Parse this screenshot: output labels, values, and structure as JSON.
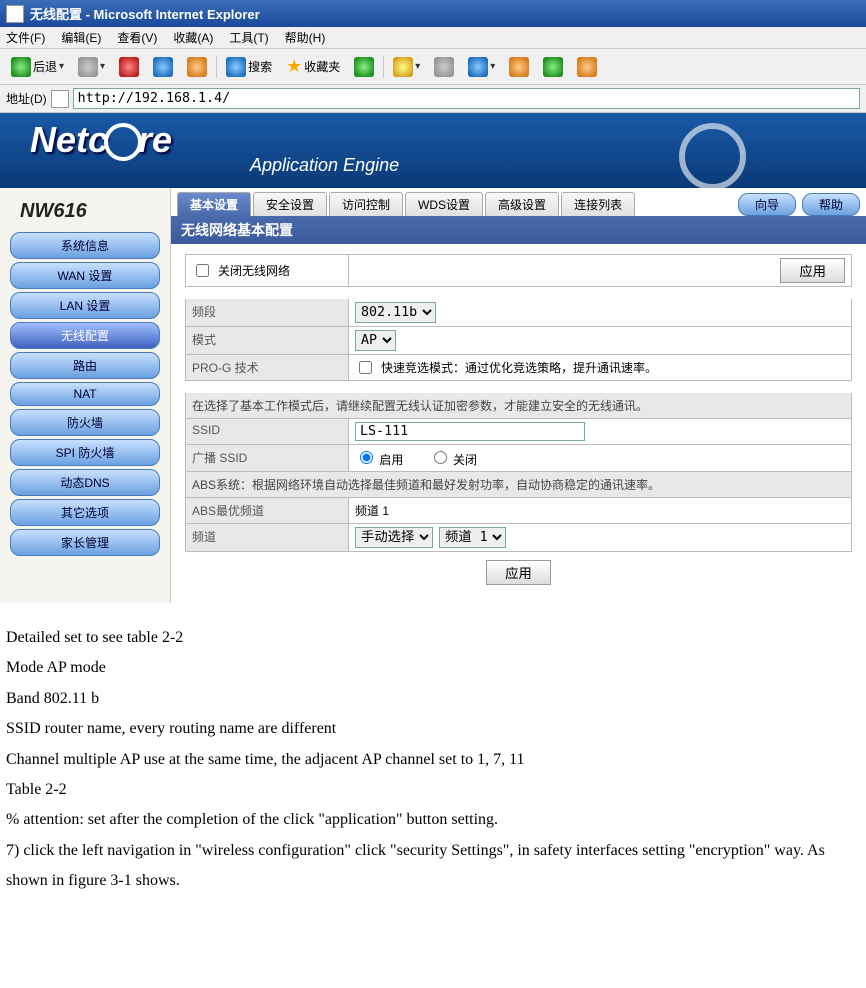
{
  "window": {
    "title": "无线配置 - Microsoft Internet Explorer"
  },
  "menu": {
    "file": "文件(F)",
    "edit": "编辑(E)",
    "view": "查看(V)",
    "fav": "收藏(A)",
    "tools": "工具(T)",
    "help": "帮助(H)"
  },
  "toolbar": {
    "back": "后退",
    "search": "搜索",
    "favorites": "收藏夹"
  },
  "address": {
    "label": "地址(D)",
    "url": "http://192.168.1.4/"
  },
  "brand": {
    "logo": "Netc   re",
    "subtitle": "Application Engine",
    "model": "NW616"
  },
  "sidebar": [
    "系统信息",
    "WAN 设置",
    "LAN 设置",
    "无线配置",
    "路由",
    "NAT",
    "防火墙",
    "SPI 防火墙",
    "动态DNS",
    "其它选项",
    "家长管理"
  ],
  "sidebar_active": 3,
  "tabs": [
    "基本设置",
    "安全设置",
    "访问控制",
    "WDS设置",
    "高级设置",
    "连接列表"
  ],
  "tab_active": 0,
  "pills": {
    "wizard": "向导",
    "help": "帮助"
  },
  "section": "无线网络基本配置",
  "form": {
    "close_wifi": "关闭无线网络",
    "apply": "应用",
    "band_label": "频段",
    "band_value": "802.11b",
    "mode_label": "模式",
    "mode_value": "AP",
    "prog_label": "PRO-G 技术",
    "prog_text": "快速竞选模式：通过优化竞选策略，提升通讯速率。",
    "note": "在选择了基本工作模式后，请继续配置无线认证加密参数，才能建立安全的无线通讯。",
    "ssid_label": "SSID",
    "ssid_value": "LS-111",
    "broadcast_label": "广播 SSID",
    "enable": "启用",
    "disable": "关闭",
    "abs_note": "ABS系统：根据网络环境自动选择最佳频道和最好发射功率，自动协商稳定的通讯速率。",
    "abs_best_label": "ABS最优频道",
    "abs_best_value": "频道 1",
    "channel_label": "频道",
    "channel_mode": "手动选择",
    "channel_value": "频道 1"
  },
  "doc": {
    "l1": "Detailed set to see table 2-2",
    "l2": "Mode AP mode",
    "l3": "Band 802.11 b",
    "l4": "SSID router name, every routing name are different",
    "l5": "Channel multiple AP use at the same time, the adjacent AP channel set to 1, 7, 11",
    "l6": "Table 2-2",
    "l7": "% attention: set after the completion of the click \"application\" button setting.",
    "l8": "7) click the left navigation in \"wireless configuration\" click \"security Settings\", in safety interfaces setting \"encryption\" way. As shown in figure 3-1 shows."
  }
}
